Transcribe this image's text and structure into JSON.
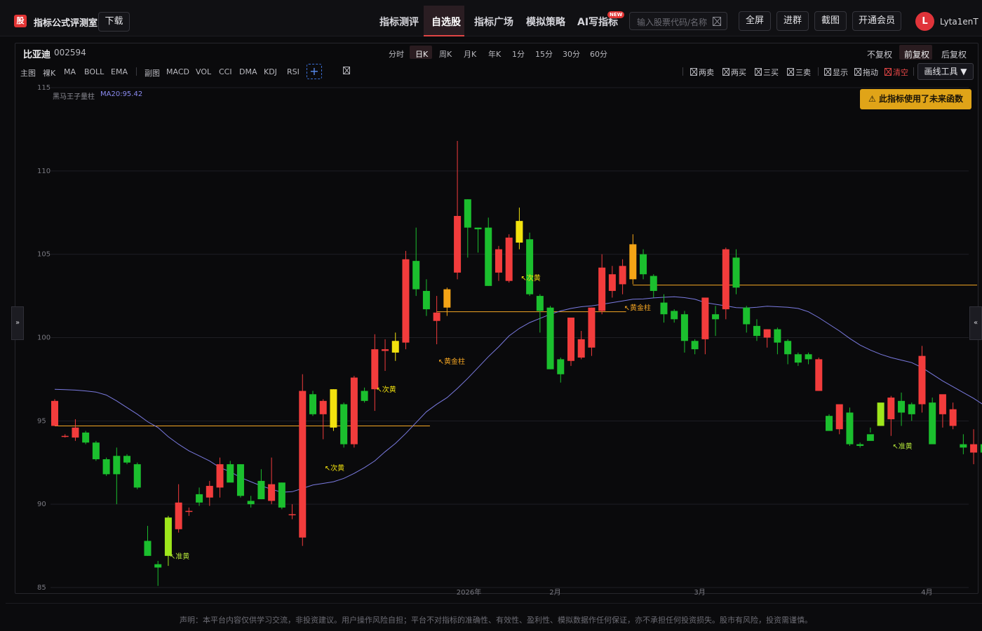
{
  "header": {
    "logo_text": "股",
    "app_title": "指标公式评测室",
    "download_label": "下载",
    "nav": [
      "指标测评",
      "自选股",
      "指标广场",
      "模拟策略",
      "AI写指标"
    ],
    "active_nav": "自选股",
    "new_badge": "NEW",
    "search_placeholder": "输入股票代码/名称",
    "buttons": [
      "全屏",
      "进群",
      "截图",
      "开通会员"
    ],
    "avatar_letter": "L",
    "username": "Lyta1enT"
  },
  "stock": {
    "name": "比亚迪",
    "code": "002594"
  },
  "periods": [
    "分时",
    "日K",
    "周K",
    "月K",
    "年K",
    "1分",
    "15分",
    "30分",
    "60分"
  ],
  "active_period": "日K",
  "adjust": [
    "不复权",
    "前复权",
    "后复权"
  ],
  "active_adjust": "前复权",
  "toolbar": {
    "main_tools": [
      "主图",
      "裸K",
      "MA",
      "BOLL",
      "EMA"
    ],
    "sub_tools": [
      "副图",
      "MACD",
      "VOL",
      "CCI",
      "DMA",
      "KDJ",
      "RSI"
    ],
    "plus": "+",
    "markers": [
      "两卖",
      "两买",
      "三买",
      "三卖",
      "显示",
      "拖动",
      "清空"
    ],
    "draw_tools_label": "画线工具 ▼"
  },
  "warning_label": "⚠ 此指标使用了未来函数",
  "indicator": {
    "name": "黑马王子量柱",
    "ma_label": "MA20:95.42"
  },
  "side_handles": {
    "left": "»",
    "right": "«"
  },
  "disclaimer": "声明：本平台内容仅供学习交流，非投资建议。用户操作风险自担；平台不对指标的准确性、有效性、盈利性、模拟数据作任何保证，亦不承担任何投资损失。股市有风险，投资需谨慎。",
  "colors": {
    "up": "#f23c3c",
    "down": "#1bbf2e",
    "gold": "#f4a416",
    "yellow": "#f2e20e",
    "lime": "#9ee61c",
    "ma": "#7a7ae0",
    "orange_line": "#f5a623",
    "label_orange": "#f5a623",
    "label_yellow": "#f2e20e",
    "label_lime": "#b5e83a"
  },
  "chart_data": {
    "type": "candlestick",
    "ylim": [
      85,
      115
    ],
    "y_ticks": [
      115,
      110,
      105,
      100,
      95,
      90,
      85
    ],
    "x_ticks": [
      {
        "label": "2026年",
        "index": 40
      },
      {
        "label": "2月",
        "index": 49
      },
      {
        "label": "3月",
        "index": 63
      },
      {
        "label": "4月",
        "index": 85
      }
    ],
    "ohlc": [
      [
        94.7,
        96.3,
        94.8,
        96.2
      ],
      [
        94.1,
        94.2,
        94.0,
        94.1
      ],
      [
        94.0,
        95.1,
        93.8,
        94.6
      ],
      [
        94.3,
        94.4,
        93.6,
        93.7
      ],
      [
        93.7,
        93.8,
        92.6,
        92.7
      ],
      [
        92.7,
        92.8,
        91.7,
        91.8
      ],
      [
        92.9,
        93.4,
        90.0,
        91.8
      ],
      [
        92.9,
        93.0,
        92.4,
        92.5
      ],
      [
        92.4,
        92.5,
        90.9,
        91.0
      ],
      [
        87.8,
        88.7,
        86.9,
        86.9
      ],
      [
        86.4,
        86.6,
        85.1,
        86.2
      ],
      [
        86.9,
        89.3,
        86.3,
        89.2
      ],
      [
        88.5,
        91.2,
        88.3,
        90.1
      ],
      [
        89.6,
        89.8,
        89.3,
        89.6
      ],
      [
        90.6,
        91.0,
        89.9,
        90.1
      ],
      [
        90.4,
        91.4,
        89.9,
        91.1
      ],
      [
        91.0,
        92.8,
        90.4,
        92.4
      ],
      [
        92.4,
        92.6,
        91.7,
        91.3
      ],
      [
        92.4,
        92.4,
        90.4,
        90.5
      ],
      [
        90.2,
        90.5,
        89.8,
        90.0
      ],
      [
        91.4,
        92.1,
        90.3,
        90.3
      ],
      [
        90.2,
        92.8,
        90.0,
        91.2
      ],
      [
        91.3,
        91.3,
        89.7,
        89.8
      ],
      [
        89.4,
        90.0,
        89.1,
        89.4
      ],
      [
        88.0,
        97.8,
        87.5,
        96.8
      ],
      [
        96.6,
        96.8,
        95.3,
        95.4
      ],
      [
        95.4,
        96.3,
        93.9,
        96.2
      ],
      [
        94.6,
        96.9,
        94.4,
        96.9
      ],
      [
        96.0,
        96.1,
        93.4,
        93.6
      ],
      [
        93.6,
        97.7,
        93.4,
        97.6
      ],
      [
        96.8,
        97.0,
        96.1,
        96.2
      ],
      [
        96.9,
        100.2,
        95.6,
        99.3
      ],
      [
        99.2,
        99.9,
        98.0,
        99.3
      ],
      [
        99.1,
        100.3,
        98.6,
        99.8
      ],
      [
        99.7,
        105.2,
        99.3,
        104.7
      ],
      [
        104.6,
        106.6,
        102.5,
        102.9
      ],
      [
        102.8,
        103.5,
        101.3,
        101.7
      ],
      [
        101.0,
        102.5,
        99.6,
        101.5
      ],
      [
        101.8,
        103.0,
        101.3,
        102.9
      ],
      [
        103.9,
        111.8,
        103.5,
        107.3
      ],
      [
        108.3,
        108.3,
        104.8,
        106.6
      ],
      [
        106.6,
        106.6,
        105.1,
        106.5
      ],
      [
        106.6,
        107.2,
        103.1,
        103.1
      ],
      [
        103.9,
        105.5,
        103.4,
        105.3
      ],
      [
        103.4,
        106.2,
        103.3,
        106.0
      ],
      [
        105.7,
        107.8,
        105.3,
        107.0
      ],
      [
        105.9,
        106.3,
        102.5,
        102.6
      ],
      [
        102.5,
        102.6,
        100.3,
        101.6
      ],
      [
        101.8,
        101.9,
        98.1,
        98.1
      ],
      [
        98.7,
        98.8,
        97.3,
        97.8
      ],
      [
        98.6,
        101.2,
        98.3,
        101.2
      ],
      [
        98.8,
        100.4,
        98.7,
        99.9
      ],
      [
        99.4,
        101.8,
        98.9,
        101.8
      ],
      [
        101.6,
        105.0,
        101.4,
        104.2
      ],
      [
        102.8,
        104.3,
        102.4,
        103.8
      ],
      [
        103.2,
        104.7,
        102.6,
        104.3
      ],
      [
        103.5,
        106.2,
        103.2,
        105.6
      ],
      [
        105.0,
        105.3,
        103.5,
        103.8
      ],
      [
        103.7,
        103.8,
        102.4,
        102.8
      ],
      [
        102.1,
        102.6,
        100.9,
        101.4
      ],
      [
        101.6,
        101.7,
        100.9,
        101.1
      ],
      [
        101.4,
        101.6,
        99.1,
        99.8
      ],
      [
        99.8,
        99.9,
        99.0,
        99.3
      ],
      [
        99.9,
        101.2,
        99.0,
        102.4
      ],
      [
        101.4,
        101.9,
        100.1,
        101.1
      ],
      [
        101.7,
        105.4,
        101.1,
        105.3
      ],
      [
        104.8,
        105.3,
        102.6,
        103.0
      ],
      [
        101.8,
        101.9,
        100.3,
        100.8
      ],
      [
        100.7,
        101.1,
        99.8,
        100.1
      ],
      [
        100.0,
        100.5,
        99.4,
        100.5
      ],
      [
        100.5,
        100.6,
        99.0,
        99.7
      ],
      [
        99.8,
        99.9,
        98.4,
        99.0
      ],
      [
        99.0,
        99.1,
        98.3,
        98.5
      ],
      [
        99.0,
        99.1,
        98.4,
        98.7
      ],
      [
        96.8,
        98.8,
        96.8,
        98.7
      ],
      [
        95.3,
        95.4,
        94.6,
        94.4
      ],
      [
        94.5,
        94.8,
        94.2,
        96.0
      ],
      [
        95.5,
        95.8,
        93.5,
        93.6
      ],
      [
        93.6,
        93.7,
        93.4,
        93.5
      ],
      [
        94.2,
        94.6,
        94.3,
        93.8
      ],
      [
        94.7,
        95.8,
        94.7,
        96.1
      ],
      [
        95.1,
        96.5,
        94.1,
        96.4
      ],
      [
        96.2,
        96.7,
        94.7,
        95.5
      ],
      [
        96.0,
        96.1,
        95.0,
        95.4
      ],
      [
        96.0,
        99.5,
        95.5,
        98.9
      ],
      [
        96.1,
        96.4,
        94.0,
        93.6
      ],
      [
        95.4,
        96.0,
        94.6,
        96.6
      ],
      [
        94.7,
        96.1,
        94.5,
        95.7
      ],
      [
        93.6,
        94.2,
        93.0,
        93.4
      ],
      [
        93.1,
        94.5,
        92.4,
        93.6
      ],
      [
        93.6,
        93.7,
        92.4,
        93.1
      ]
    ],
    "bar_styles": {
      "9": "down",
      "11": "lime",
      "27": "yellow",
      "33": "yellow",
      "38": "gold",
      "45": "yellow",
      "56": "gold",
      "80": "lime"
    },
    "ma20": [
      96.9,
      96.88,
      96.85,
      96.8,
      96.73,
      96.55,
      96.2,
      95.8,
      95.4,
      94.95,
      94.6,
      94.05,
      93.6,
      93.2,
      92.9,
      92.6,
      92.2,
      91.95,
      91.6,
      91.35,
      91.1,
      90.9,
      90.72,
      90.75,
      90.95,
      91.15,
      91.25,
      91.35,
      91.55,
      91.85,
      92.2,
      92.6,
      93.15,
      93.65,
      94.25,
      94.9,
      95.55,
      96.0,
      96.4,
      96.95,
      97.55,
      98.2,
      98.85,
      99.45,
      100.1,
      100.55,
      100.9,
      101.15,
      101.4,
      101.6,
      101.75,
      101.85,
      101.9,
      102.0,
      102.1,
      102.2,
      102.3,
      102.32,
      102.38,
      102.42,
      102.45,
      102.4,
      102.3,
      102.1,
      102.0,
      101.9,
      101.8,
      101.78,
      101.82,
      101.88,
      101.85,
      101.82,
      101.75,
      101.55,
      101.2,
      100.8,
      100.4,
      99.95,
      99.55,
      99.25,
      99.0,
      98.8,
      98.65,
      98.5,
      98.2,
      97.8,
      97.4,
      97.05,
      96.7,
      96.35,
      95.95
    ],
    "horizontal_lines": [
      {
        "value": 94.7,
        "from_index": 0,
        "to_index": 36
      },
      {
        "value": 101.55,
        "from_index": 37,
        "to_index": 55
      },
      {
        "value": 103.15,
        "from_index": 56,
        "to_index": 89
      }
    ],
    "annotations": [
      {
        "text": "↖准黄",
        "index": 11,
        "value": 86.9,
        "color": "lime"
      },
      {
        "text": "↖次黄",
        "index": 26,
        "value": 92.2,
        "color": "yellow"
      },
      {
        "text": "↖次黄",
        "index": 31,
        "value": 96.9,
        "color": "yellow"
      },
      {
        "text": "↖黄金柱",
        "index": 37,
        "value": 98.6,
        "color": "orange"
      },
      {
        "text": "↖次黄",
        "index": 45,
        "value": 103.6,
        "color": "yellow"
      },
      {
        "text": "↖黄金柱",
        "index": 55,
        "value": 101.8,
        "color": "orange"
      },
      {
        "text": "↖准黄",
        "index": 81,
        "value": 93.5,
        "color": "lime"
      }
    ]
  }
}
